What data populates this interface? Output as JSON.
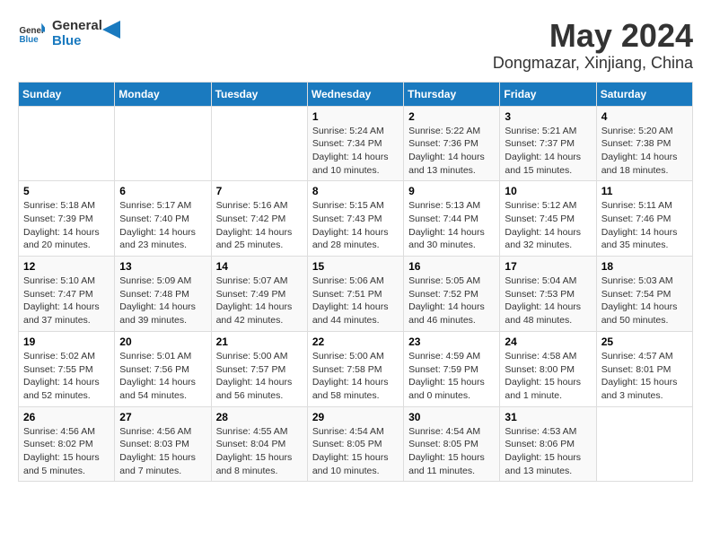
{
  "logo": {
    "text_general": "General",
    "text_blue": "Blue"
  },
  "title": "May 2024",
  "subtitle": "Dongmazar, Xinjiang, China",
  "days_of_week": [
    "Sunday",
    "Monday",
    "Tuesday",
    "Wednesday",
    "Thursday",
    "Friday",
    "Saturday"
  ],
  "weeks": [
    [
      {
        "day": "",
        "info": ""
      },
      {
        "day": "",
        "info": ""
      },
      {
        "day": "",
        "info": ""
      },
      {
        "day": "1",
        "info": "Sunrise: 5:24 AM\nSunset: 7:34 PM\nDaylight: 14 hours\nand 10 minutes."
      },
      {
        "day": "2",
        "info": "Sunrise: 5:22 AM\nSunset: 7:36 PM\nDaylight: 14 hours\nand 13 minutes."
      },
      {
        "day": "3",
        "info": "Sunrise: 5:21 AM\nSunset: 7:37 PM\nDaylight: 14 hours\nand 15 minutes."
      },
      {
        "day": "4",
        "info": "Sunrise: 5:20 AM\nSunset: 7:38 PM\nDaylight: 14 hours\nand 18 minutes."
      }
    ],
    [
      {
        "day": "5",
        "info": "Sunrise: 5:18 AM\nSunset: 7:39 PM\nDaylight: 14 hours\nand 20 minutes."
      },
      {
        "day": "6",
        "info": "Sunrise: 5:17 AM\nSunset: 7:40 PM\nDaylight: 14 hours\nand 23 minutes."
      },
      {
        "day": "7",
        "info": "Sunrise: 5:16 AM\nSunset: 7:42 PM\nDaylight: 14 hours\nand 25 minutes."
      },
      {
        "day": "8",
        "info": "Sunrise: 5:15 AM\nSunset: 7:43 PM\nDaylight: 14 hours\nand 28 minutes."
      },
      {
        "day": "9",
        "info": "Sunrise: 5:13 AM\nSunset: 7:44 PM\nDaylight: 14 hours\nand 30 minutes."
      },
      {
        "day": "10",
        "info": "Sunrise: 5:12 AM\nSunset: 7:45 PM\nDaylight: 14 hours\nand 32 minutes."
      },
      {
        "day": "11",
        "info": "Sunrise: 5:11 AM\nSunset: 7:46 PM\nDaylight: 14 hours\nand 35 minutes."
      }
    ],
    [
      {
        "day": "12",
        "info": "Sunrise: 5:10 AM\nSunset: 7:47 PM\nDaylight: 14 hours\nand 37 minutes."
      },
      {
        "day": "13",
        "info": "Sunrise: 5:09 AM\nSunset: 7:48 PM\nDaylight: 14 hours\nand 39 minutes."
      },
      {
        "day": "14",
        "info": "Sunrise: 5:07 AM\nSunset: 7:49 PM\nDaylight: 14 hours\nand 42 minutes."
      },
      {
        "day": "15",
        "info": "Sunrise: 5:06 AM\nSunset: 7:51 PM\nDaylight: 14 hours\nand 44 minutes."
      },
      {
        "day": "16",
        "info": "Sunrise: 5:05 AM\nSunset: 7:52 PM\nDaylight: 14 hours\nand 46 minutes."
      },
      {
        "day": "17",
        "info": "Sunrise: 5:04 AM\nSunset: 7:53 PM\nDaylight: 14 hours\nand 48 minutes."
      },
      {
        "day": "18",
        "info": "Sunrise: 5:03 AM\nSunset: 7:54 PM\nDaylight: 14 hours\nand 50 minutes."
      }
    ],
    [
      {
        "day": "19",
        "info": "Sunrise: 5:02 AM\nSunset: 7:55 PM\nDaylight: 14 hours\nand 52 minutes."
      },
      {
        "day": "20",
        "info": "Sunrise: 5:01 AM\nSunset: 7:56 PM\nDaylight: 14 hours\nand 54 minutes."
      },
      {
        "day": "21",
        "info": "Sunrise: 5:00 AM\nSunset: 7:57 PM\nDaylight: 14 hours\nand 56 minutes."
      },
      {
        "day": "22",
        "info": "Sunrise: 5:00 AM\nSunset: 7:58 PM\nDaylight: 14 hours\nand 58 minutes."
      },
      {
        "day": "23",
        "info": "Sunrise: 4:59 AM\nSunset: 7:59 PM\nDaylight: 15 hours\nand 0 minutes."
      },
      {
        "day": "24",
        "info": "Sunrise: 4:58 AM\nSunset: 8:00 PM\nDaylight: 15 hours\nand 1 minute."
      },
      {
        "day": "25",
        "info": "Sunrise: 4:57 AM\nSunset: 8:01 PM\nDaylight: 15 hours\nand 3 minutes."
      }
    ],
    [
      {
        "day": "26",
        "info": "Sunrise: 4:56 AM\nSunset: 8:02 PM\nDaylight: 15 hours\nand 5 minutes."
      },
      {
        "day": "27",
        "info": "Sunrise: 4:56 AM\nSunset: 8:03 PM\nDaylight: 15 hours\nand 7 minutes."
      },
      {
        "day": "28",
        "info": "Sunrise: 4:55 AM\nSunset: 8:04 PM\nDaylight: 15 hours\nand 8 minutes."
      },
      {
        "day": "29",
        "info": "Sunrise: 4:54 AM\nSunset: 8:05 PM\nDaylight: 15 hours\nand 10 minutes."
      },
      {
        "day": "30",
        "info": "Sunrise: 4:54 AM\nSunset: 8:05 PM\nDaylight: 15 hours\nand 11 minutes."
      },
      {
        "day": "31",
        "info": "Sunrise: 4:53 AM\nSunset: 8:06 PM\nDaylight: 15 hours\nand 13 minutes."
      },
      {
        "day": "",
        "info": ""
      }
    ]
  ]
}
